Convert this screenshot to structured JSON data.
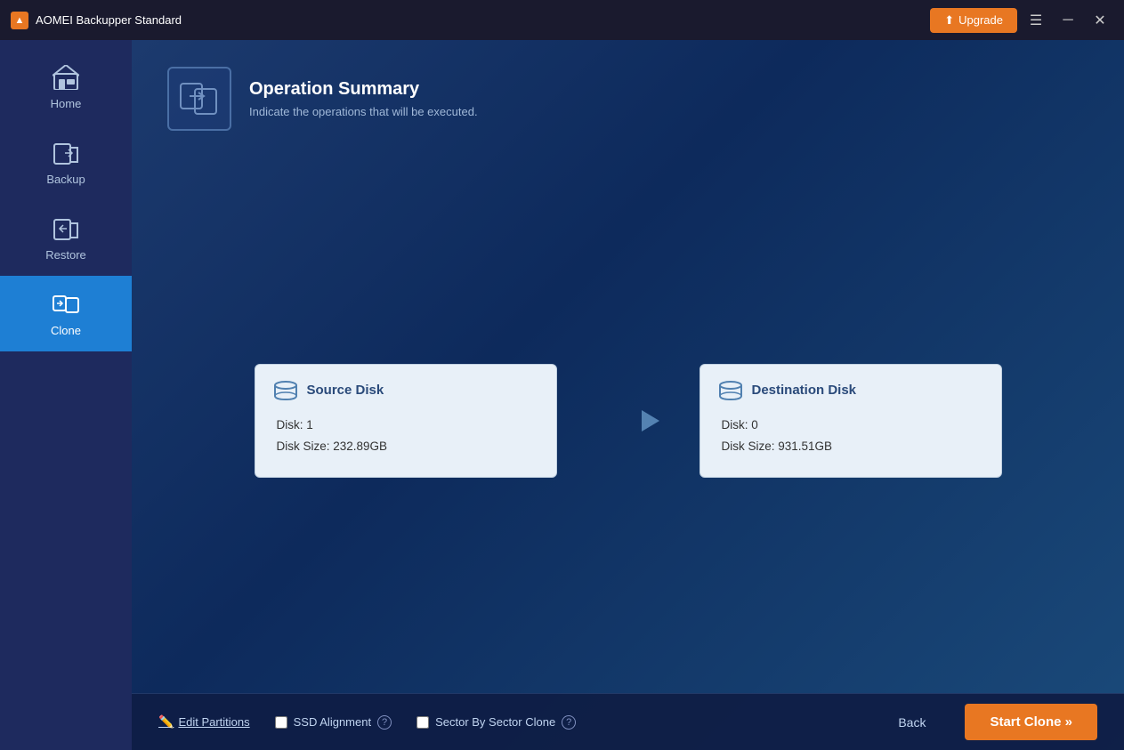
{
  "app": {
    "title": "AOMEI Backupper Standard",
    "upgrade_label": "Upgrade"
  },
  "sidebar": {
    "items": [
      {
        "id": "home",
        "label": "Home",
        "active": false
      },
      {
        "id": "backup",
        "label": "Backup",
        "active": false
      },
      {
        "id": "restore",
        "label": "Restore",
        "active": false
      },
      {
        "id": "clone",
        "label": "Clone",
        "active": true
      }
    ]
  },
  "header": {
    "title": "Operation Summary",
    "subtitle": "Indicate the operations that will be executed."
  },
  "source_disk": {
    "label": "Source Disk",
    "disk_number": "Disk: 1",
    "disk_size": "Disk Size: 232.89GB"
  },
  "destination_disk": {
    "label": "Destination Disk",
    "disk_number": "Disk: 0",
    "disk_size": "Disk Size: 931.51GB"
  },
  "footer": {
    "edit_partitions_label": "Edit Partitions",
    "ssd_alignment_label": "SSD Alignment",
    "sector_by_sector_label": "Sector By Sector Clone",
    "back_label": "Back",
    "start_clone_label": "Start Clone »"
  }
}
